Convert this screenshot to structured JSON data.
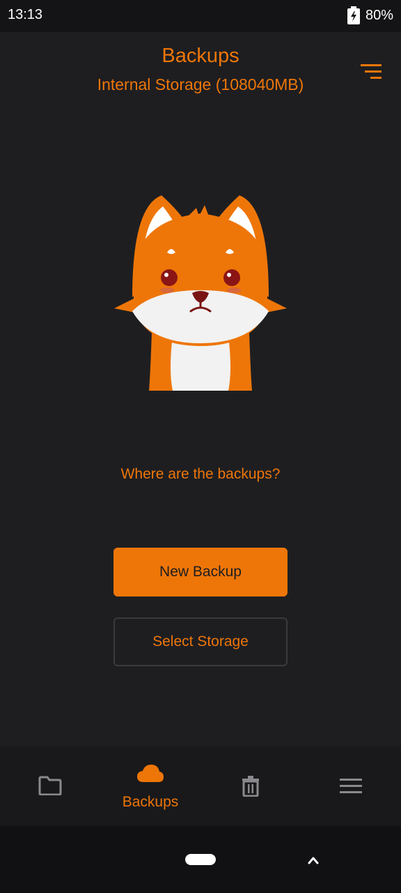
{
  "status": {
    "time": "13:13",
    "battery": "80%"
  },
  "appbar": {
    "title": "Backups",
    "subtitle": "Internal Storage (108040MB)",
    "sort_icon": "sort-filter-icon"
  },
  "empty_state": {
    "illustration": "sad-fox-illustration",
    "message": "Where are the backups?"
  },
  "buttons": {
    "new_backup": "New Backup",
    "select_storage": "Select Storage"
  },
  "nav": {
    "items": [
      {
        "icon": "folder-icon",
        "label": ""
      },
      {
        "icon": "cloud-icon",
        "label": "Backups",
        "active": true
      },
      {
        "icon": "trash-icon",
        "label": ""
      },
      {
        "icon": "menu-icon",
        "label": ""
      }
    ]
  },
  "colors": {
    "accent": "#ee7608",
    "background": "#1e1e21",
    "inactive_icon": "#8a8a8e"
  }
}
